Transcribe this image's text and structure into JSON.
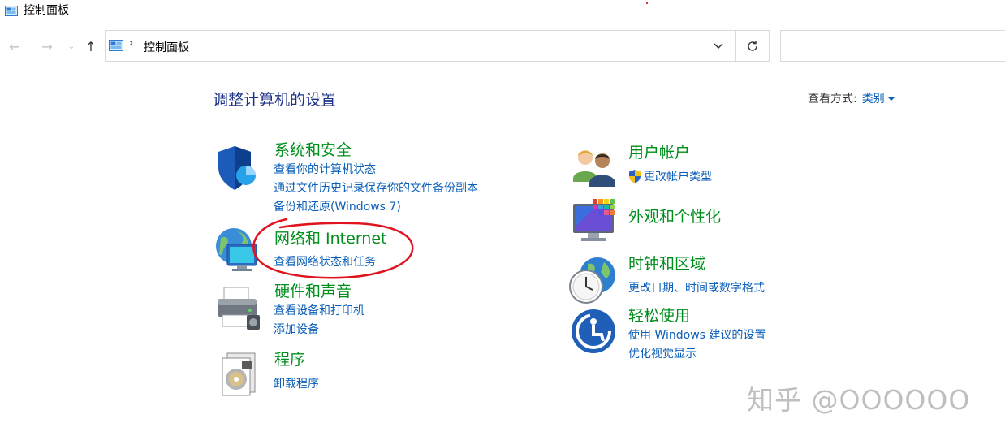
{
  "window": {
    "title": "控制面板"
  },
  "nav": {
    "breadcrumb": "控制面板",
    "search_placeholder": ""
  },
  "header": {
    "title": "调整计算机的设置",
    "view_by_label": "查看方式:",
    "view_by_value": "类别"
  },
  "left_categories": [
    {
      "heading": "系统和安全",
      "links": [
        "查看你的计算机状态",
        "通过文件历史记录保存你的文件备份副本",
        "备份和还原(Windows 7)"
      ]
    },
    {
      "heading": "网络和 Internet",
      "links": [
        "查看网络状态和任务"
      ]
    },
    {
      "heading": "硬件和声音",
      "links": [
        "查看设备和打印机",
        "添加设备"
      ]
    },
    {
      "heading": "程序",
      "links": [
        "卸载程序"
      ]
    }
  ],
  "right_categories": [
    {
      "heading": "用户帐户",
      "links": [
        "更改帐户类型"
      ]
    },
    {
      "heading": "外观和个性化",
      "links": []
    },
    {
      "heading": "时钟和区域",
      "links": [
        "更改日期、时间或数字格式"
      ]
    },
    {
      "heading": "轻松使用",
      "links": [
        "使用 Windows 建议的设置",
        "优化视觉显示"
      ]
    }
  ],
  "watermark": "知乎 @OOOOOO",
  "colors": {
    "heading": "#008e1c",
    "link": "#0b5fb8",
    "title": "#1e3287",
    "annotation": "#e0141e"
  }
}
